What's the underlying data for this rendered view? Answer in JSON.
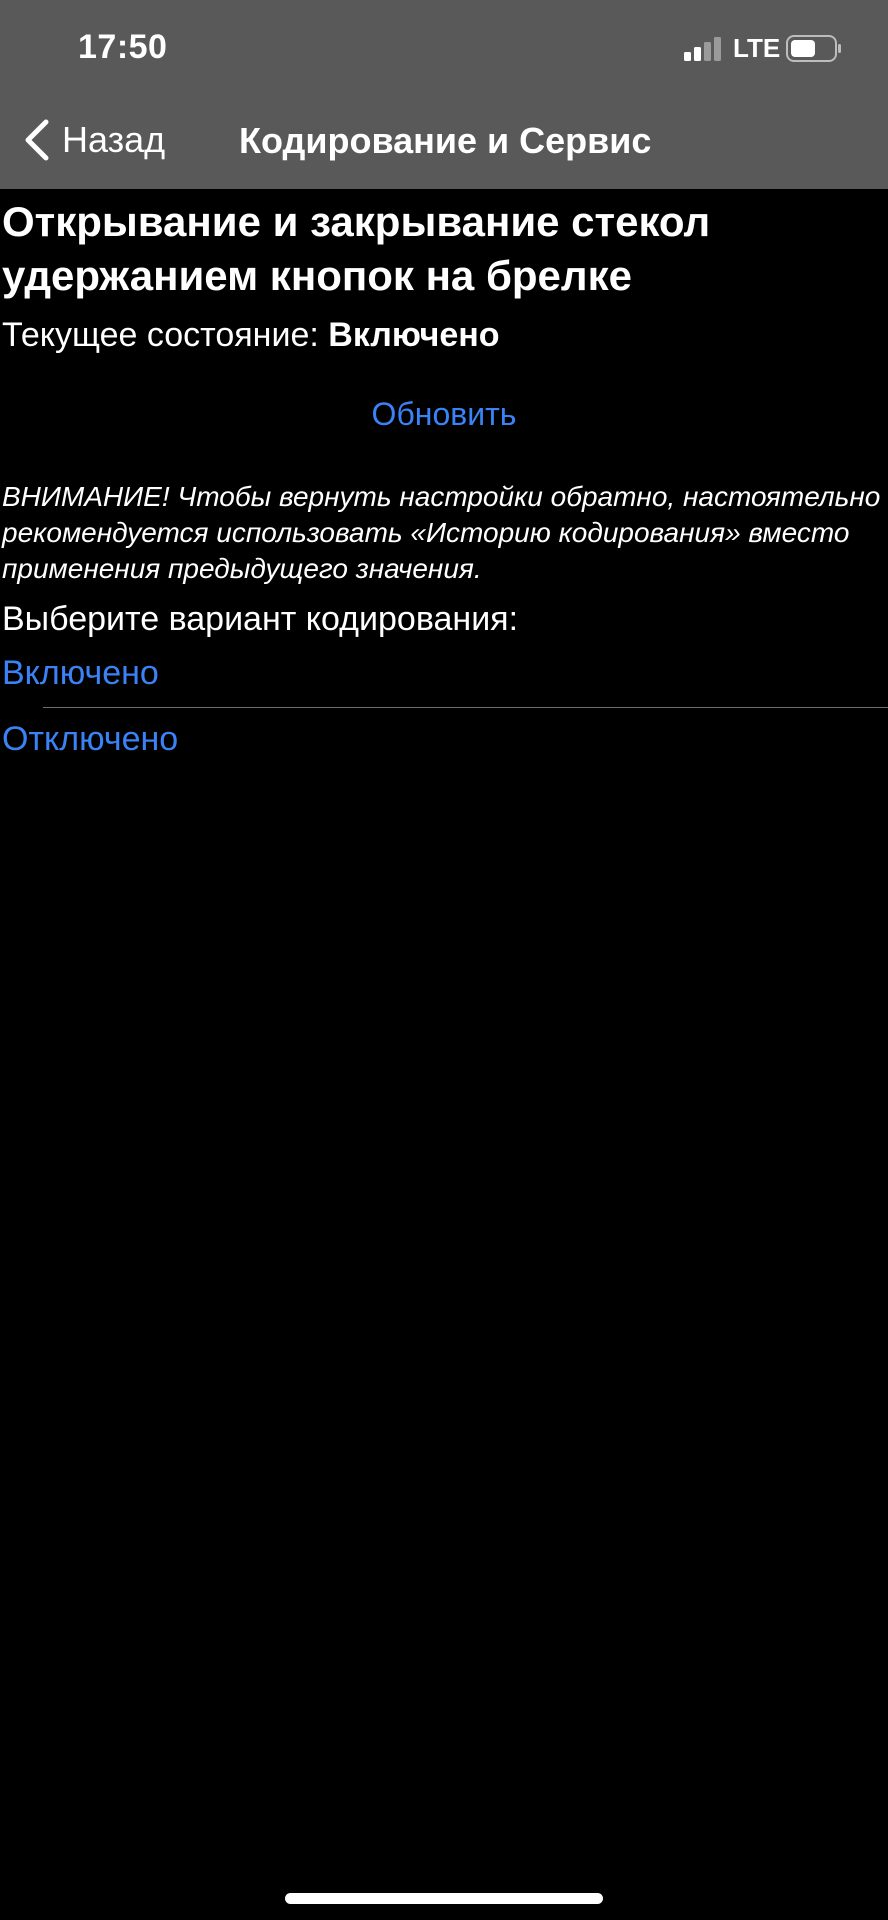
{
  "status_bar": {
    "time": "17:50",
    "network": "LTE",
    "signal_icon": "signal-bars-icon",
    "battery_icon": "battery-icon"
  },
  "nav": {
    "back_label": "Назад",
    "title": "Кодирование и Сервис",
    "back_icon": "chevron-left-icon"
  },
  "main": {
    "feature_title": "Открывание и закрывание стекол удержанием кнопок на брелке",
    "state_label": "Текущее состояние: ",
    "state_value": "Включено",
    "refresh_label": "Обновить",
    "warning_text": "ВНИМАНИЕ! Чтобы вернуть настройки обратно, настоятельно рекомендуется использовать «Историю кодирования» вместо применения предыдущего значения.",
    "choose_label": "Выберите вариант кодирования:",
    "options": [
      {
        "label": "Включено"
      },
      {
        "label": "Отключено"
      }
    ]
  },
  "colors": {
    "header_bg": "#595959",
    "background": "#000000",
    "accent": "#3b82f6",
    "text": "#ffffff"
  }
}
